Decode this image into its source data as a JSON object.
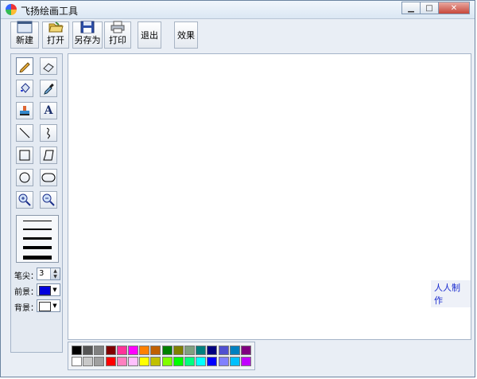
{
  "window": {
    "title": "飞扬绘画工具",
    "controls": [
      "minimize",
      "maximize",
      "close"
    ]
  },
  "toolbar": {
    "buttons": [
      {
        "id": "new",
        "label": "新建",
        "icon": "new-file-icon"
      },
      {
        "id": "open",
        "label": "打开",
        "icon": "open-folder-icon"
      },
      {
        "id": "saveas",
        "label": "另存为",
        "icon": "floppy-disk-icon"
      },
      {
        "id": "print",
        "label": "打印",
        "icon": "printer-icon"
      },
      {
        "id": "exit",
        "label": "退出",
        "icon": ""
      },
      {
        "id": "effects",
        "label": "效果",
        "icon": ""
      }
    ]
  },
  "tools": [
    {
      "name": "pencil",
      "icon": "pencil-icon",
      "selected": true
    },
    {
      "name": "eraser",
      "icon": "eraser-icon"
    },
    {
      "name": "fill",
      "icon": "paint-bucket-icon"
    },
    {
      "name": "eyedropper",
      "icon": "eyedropper-icon"
    },
    {
      "name": "stamp",
      "icon": "stamp-icon"
    },
    {
      "name": "text",
      "icon": "text-icon",
      "glyph": "A"
    },
    {
      "name": "line",
      "icon": "line-icon"
    },
    {
      "name": "curve",
      "icon": "curve-icon"
    },
    {
      "name": "rectangle",
      "icon": "rectangle-icon"
    },
    {
      "name": "polygon",
      "icon": "polygon-icon"
    },
    {
      "name": "ellipse",
      "icon": "ellipse-icon"
    },
    {
      "name": "rounded-rect",
      "icon": "rounded-rect-icon"
    },
    {
      "name": "zoom-in",
      "icon": "zoom-in-icon"
    },
    {
      "name": "zoom-out",
      "icon": "zoom-out-icon"
    }
  ],
  "line_widths": {
    "levels": 5
  },
  "props": {
    "brush_label": "笔尖：",
    "brush_size": "3",
    "foreground_label": "前景：",
    "foreground_color": "#0000dd",
    "background_label": "背景：",
    "background_color": "#ffffff"
  },
  "canvas": {
    "credit": "人人制作"
  },
  "palette": {
    "row1": [
      "#000000",
      "#555555",
      "#808080",
      "#800000",
      "#ff3399",
      "#ff00ff",
      "#ff8000",
      "#c06000",
      "#008000",
      "#808000",
      "#80a080",
      "#008080",
      "#000080",
      "#5050d0",
      "#0080c0",
      "#800080"
    ],
    "row2": [
      "#ffffff",
      "#c8c8c8",
      "#a0a0a0",
      "#ff0000",
      "#ff80c0",
      "#ffc0ff",
      "#ffff00",
      "#c0c000",
      "#80ff00",
      "#00ff00",
      "#00ff80",
      "#00ffff",
      "#0000ff",
      "#8080ff",
      "#00c0ff",
      "#c000ff"
    ]
  }
}
